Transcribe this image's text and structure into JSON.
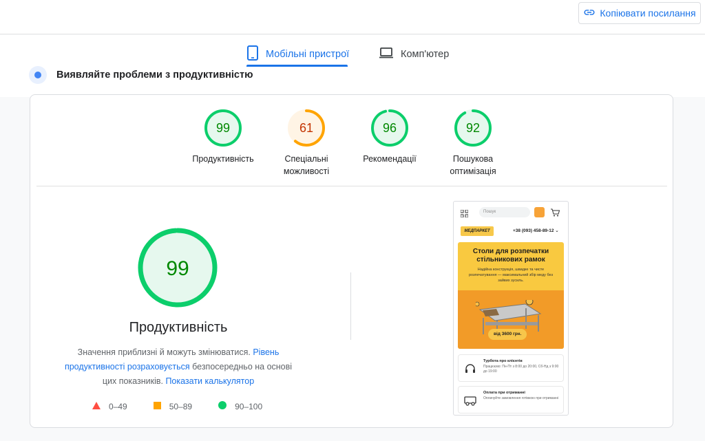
{
  "header": {
    "copy_link_label": "Копіювати посилання",
    "copy_link_icon": "link-icon"
  },
  "tabs": [
    {
      "label": "Мобільні пристрої",
      "icon": "smartphone-icon",
      "active": true
    },
    {
      "label": "Комп'ютер",
      "icon": "laptop-icon",
      "active": false
    }
  ],
  "section": {
    "title": "Виявляйте проблеми з продуктивністю"
  },
  "scores": [
    {
      "label_line1": "Продуктивність",
      "label_line2": "",
      "value": "99",
      "color": "#0cce6b",
      "text_color": "#008800",
      "bg": "#e6f8ee",
      "fraction": 0.99
    },
    {
      "label_line1": "Спеціальні",
      "label_line2": "можливості",
      "value": "61",
      "color": "#ffa400",
      "text_color": "#c33300",
      "bg": "#fff4e5",
      "fraction": 0.61
    },
    {
      "label_line1": "Рекомендації",
      "label_line2": "",
      "value": "96",
      "color": "#0cce6b",
      "text_color": "#008800",
      "bg": "#e6f8ee",
      "fraction": 0.96
    },
    {
      "label_line1": "Пошукова",
      "label_line2": "оптимізація",
      "value": "92",
      "color": "#0cce6b",
      "text_color": "#008800",
      "bg": "#e6f8ee",
      "fraction": 0.92
    }
  ],
  "performance": {
    "score": "99",
    "fraction": 0.99,
    "title": "Продуктивність",
    "desc_part1": "Значення приблизні й можуть змінюватися. ",
    "desc_link1": "Рівень продуктивності розраховується",
    "desc_part2": " безпосередньо на основі цих показників. ",
    "desc_link2": "Показати калькулятор"
  },
  "legend": [
    {
      "range": "0–49",
      "shape": "triangle",
      "color": "#ff4e42"
    },
    {
      "range": "50–89",
      "shape": "square",
      "color": "#ffa400"
    },
    {
      "range": "90–100",
      "shape": "circle",
      "color": "#0cce6b"
    }
  ],
  "screenshot": {
    "search_placeholder": "Пошук",
    "logo_text": "МЕДПАРКЕТ",
    "phone_number": "+38 (093) 458-89-12 ⌄",
    "banner_title": "Столи для розпечатки стільникових рамок",
    "banner_text": "Надійна конструкція, швидке та чисте розпечатування — максимальний збір меду без зайвих зусиль.",
    "price_label": "від 3600 грн.",
    "info1_title": "Турбота про клієнтів",
    "info1_text": "Працюємо: Пн-Пт з 8:00 до 20:00, Сб-Нд з 9:00 до 19:00",
    "info2_title": "Оплата при отриманні",
    "info2_text": "Оплачуйте замовлення готівкою при отриманні"
  }
}
